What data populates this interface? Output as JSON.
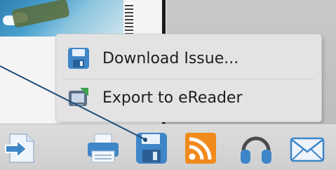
{
  "menu": {
    "items": [
      {
        "label": "Download Issue...",
        "icon": "floppy-disk-icon"
      },
      {
        "label": "Export to eReader",
        "icon": "ereader-export-icon"
      }
    ]
  },
  "toolbar": {
    "buttons": [
      {
        "icon": "next-page-icon"
      },
      {
        "icon": "print-icon"
      },
      {
        "icon": "save-icon",
        "active": true
      },
      {
        "icon": "rss-icon"
      },
      {
        "icon": "headphones-icon"
      },
      {
        "icon": "email-icon"
      }
    ]
  },
  "colors": {
    "rss_orange": "#f08a1c",
    "icon_blue": "#3f86c8",
    "pointer_line": "#1f4e79"
  }
}
